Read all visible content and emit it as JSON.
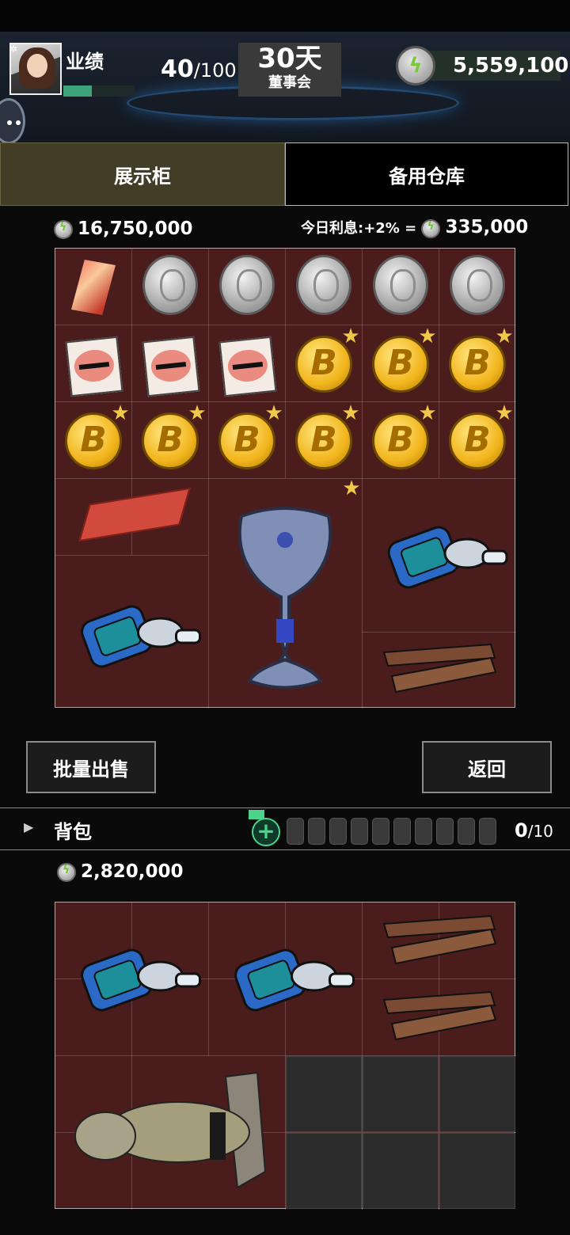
{
  "header": {
    "performance_label": "业绩",
    "performance_current": "40",
    "performance_max": "/100",
    "performance_progress": 0.4,
    "days": "30天",
    "days_sub": "董事会",
    "money": "5,559,100"
  },
  "tabs": [
    {
      "label": "展示柜",
      "active": true
    },
    {
      "label": "备用仓库",
      "active": false
    }
  ],
  "showcase": {
    "total_value": "16,750,000",
    "interest_label": "今日利息:+2% =",
    "interest_value": "335,000"
  },
  "buttons": {
    "bulk_sell": "批量出售",
    "back": "返回"
  },
  "backpack": {
    "label": "背包",
    "count": "0",
    "capacity": "/10",
    "total_value": "2,820,000"
  },
  "colors": {
    "grid_bg": "#4a1c1c",
    "active_tab": "#423d27",
    "accent_green": "#4bd38a",
    "star": "#f0c84a"
  }
}
